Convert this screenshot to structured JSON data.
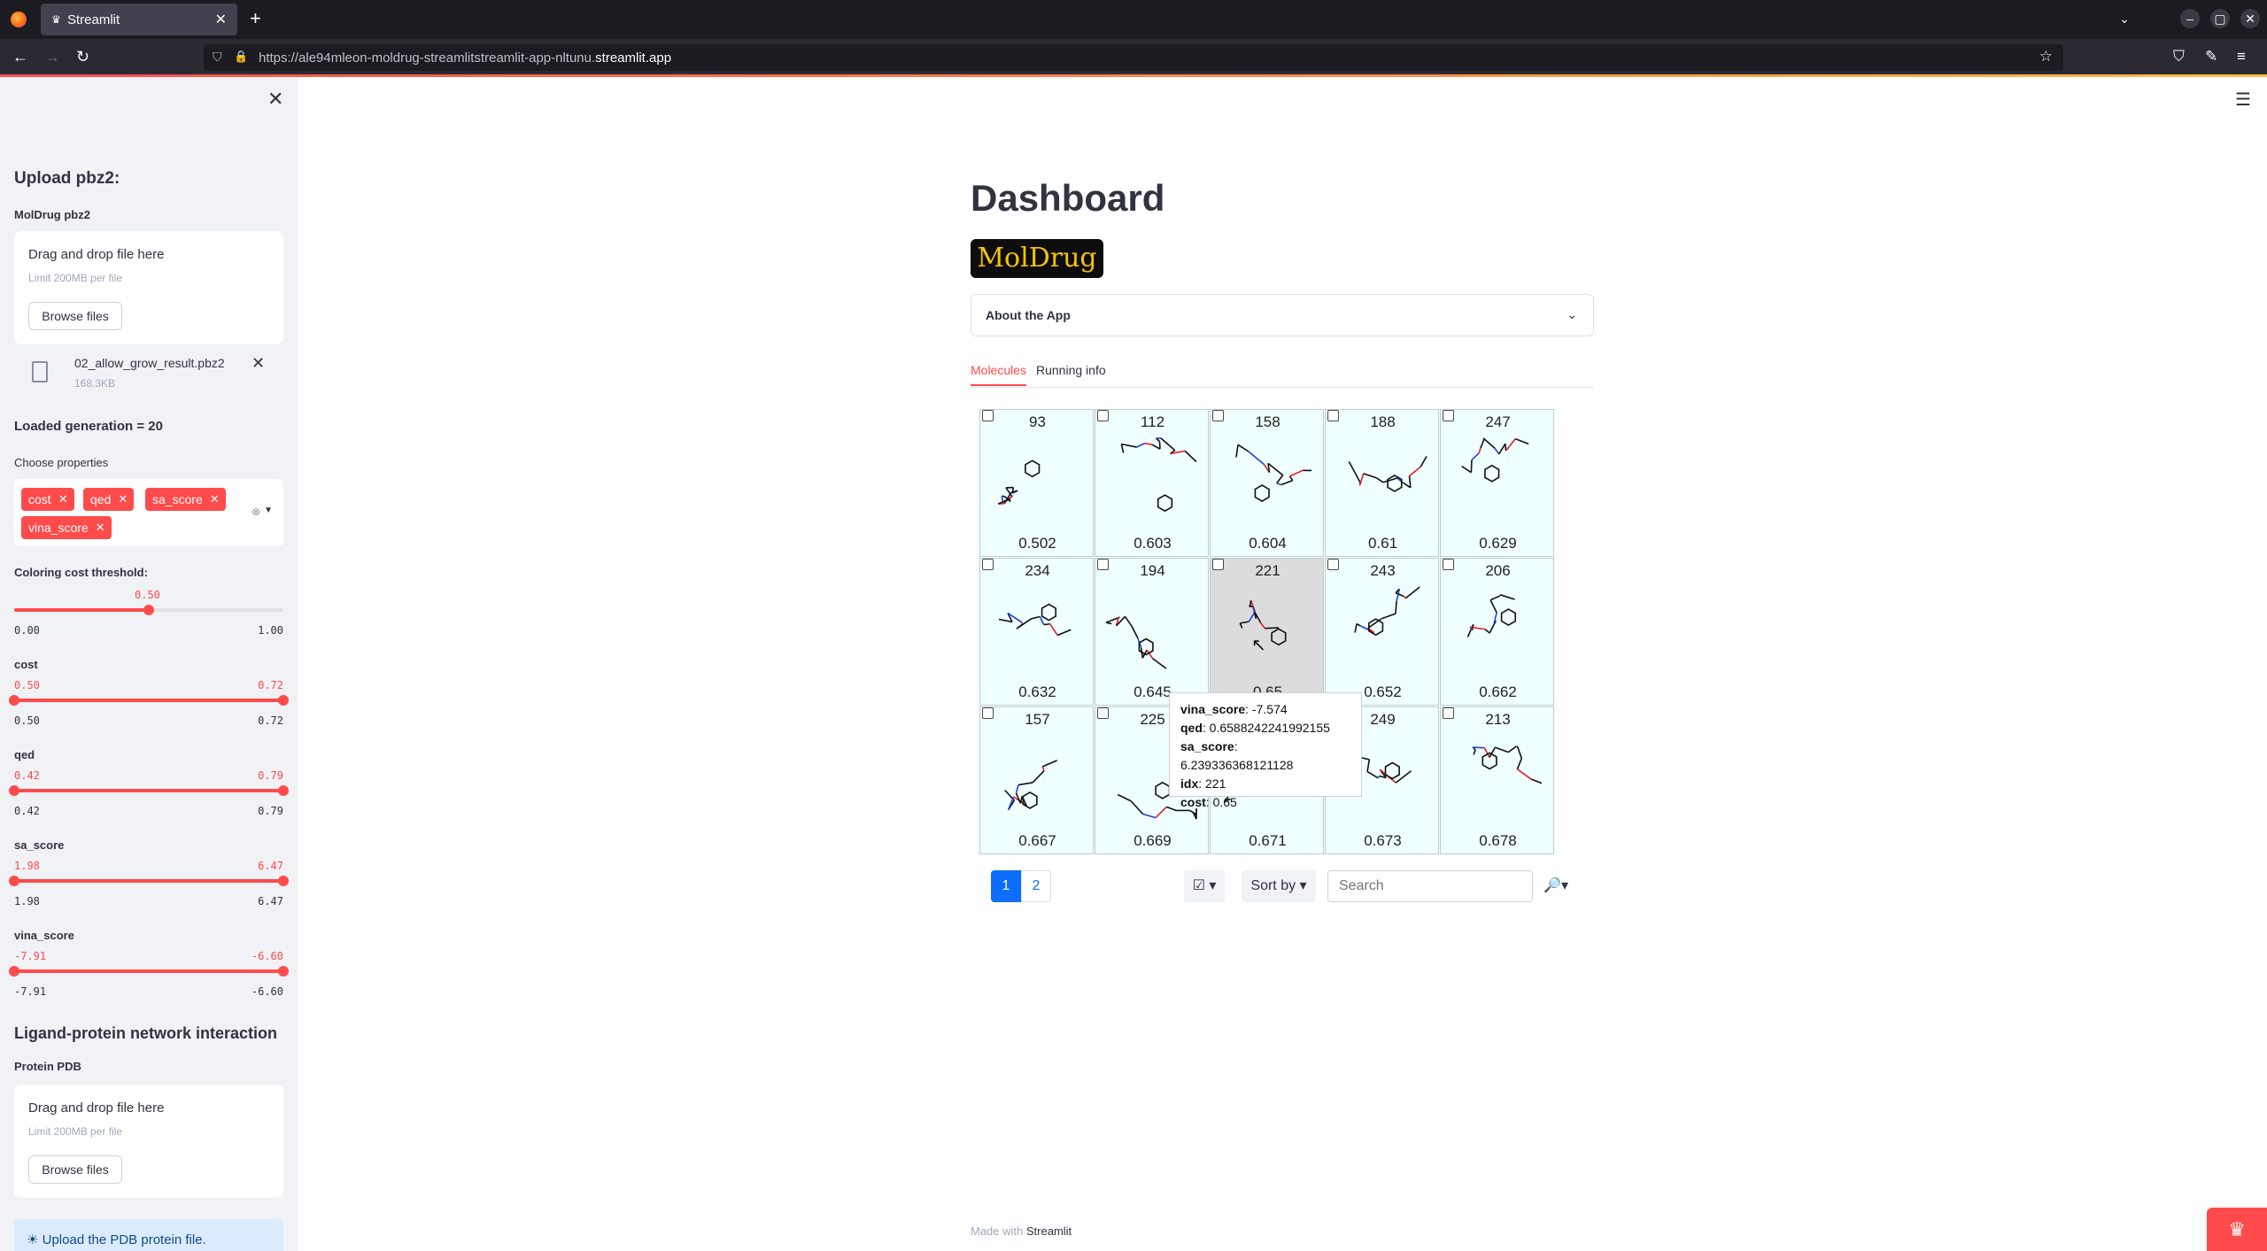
{
  "browser": {
    "tab_title": "Streamlit",
    "url_prefix": "https://ale94mleon-moldrug-streamlitstreamlit-app-nltunu.",
    "url_domain": "streamlit.app"
  },
  "sidebar": {
    "upload_heading": "Upload pbz2:",
    "uploader_label": "MolDrug pbz2",
    "uploader": {
      "drag_text": "Drag and drop file here",
      "limit": "Limit 200MB per file",
      "browse": "Browse files"
    },
    "file": {
      "name": "02_allow_grow_result.pbz2",
      "size": "168.3KB"
    },
    "loaded_generation": "Loaded generation = 20",
    "choose_label": "Choose properties",
    "chips": [
      "cost",
      "qed",
      "sa_score",
      "vina_score"
    ],
    "threshold": {
      "label": "Coloring cost threshold:",
      "value": "0.50",
      "min": "0.00",
      "max": "1.00",
      "frac": 0.5
    },
    "range_sliders": [
      {
        "label": "cost",
        "lo": "0.50",
        "hi": "0.72",
        "min": "0.50",
        "max": "0.72"
      },
      {
        "label": "qed",
        "lo": "0.42",
        "hi": "0.79",
        "min": "0.42",
        "max": "0.79"
      },
      {
        "label": "sa_score",
        "lo": "1.98",
        "hi": "6.47",
        "min": "1.98",
        "max": "6.47"
      },
      {
        "label": "vina_score",
        "lo": "-7.91",
        "hi": "-6.60",
        "min": "-7.91",
        "max": "-6.60"
      }
    ],
    "network_heading": "Ligand-protein network interaction",
    "protein_label": "Protein PDB",
    "uploader2": {
      "drag_text": "Drag and drop file here",
      "limit": "Limit 200MB per file",
      "browse": "Browse files"
    },
    "info": "Upload the PDB protein file."
  },
  "main": {
    "title": "Dashboard",
    "logo_text": "MolDrug",
    "expander": "About the App",
    "tabs": [
      "Molecules",
      "Running info"
    ],
    "molecules": [
      {
        "idx": "93",
        "score": "0.502"
      },
      {
        "idx": "112",
        "score": "0.603"
      },
      {
        "idx": "158",
        "score": "0.604"
      },
      {
        "idx": "188",
        "score": "0.61"
      },
      {
        "idx": "247",
        "score": "0.629"
      },
      {
        "idx": "234",
        "score": "0.632"
      },
      {
        "idx": "194",
        "score": "0.645"
      },
      {
        "idx": "221",
        "score": "0.65"
      },
      {
        "idx": "243",
        "score": "0.652"
      },
      {
        "idx": "206",
        "score": "0.662"
      },
      {
        "idx": "157",
        "score": "0.667"
      },
      {
        "idx": "225",
        "score": "0.669"
      },
      {
        "idx": "",
        "score": "0.671"
      },
      {
        "idx": "249",
        "score": "0.673"
      },
      {
        "idx": "213",
        "score": "0.678"
      }
    ],
    "tooltip": {
      "vina_key": "vina_score",
      "vina_val": ": -7.574",
      "qed_key": "qed",
      "qed_val": ": 0.6588242241992155",
      "sa_key": "sa_score",
      "sa_val": ": 6.239336368121128",
      "idx_key": "idx",
      "idx_val": ": 221",
      "cost_key": "cost",
      "cost_val": ": 0.65"
    },
    "pages": [
      "1",
      "2"
    ],
    "select_icon": "☑",
    "sort_label": "Sort by",
    "search_placeholder": "Search",
    "search_icon": "🔎"
  },
  "footer": {
    "made_with": "Made with",
    "brand": "Streamlit"
  },
  "colors": {
    "accent": "#ff4b4b",
    "cell_bg": "#f0ffff",
    "link": "#0d6efd"
  }
}
